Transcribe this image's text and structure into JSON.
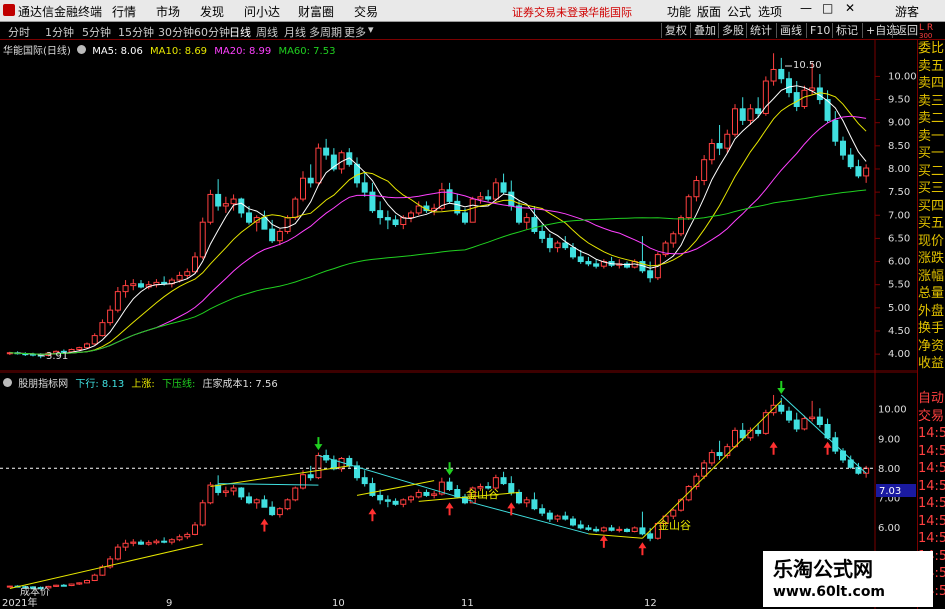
{
  "menu": {
    "logo_text": "通达信金融终端",
    "items": [
      "行情",
      "市场",
      "发现",
      "问小达",
      "财富圈",
      "交易"
    ],
    "broker_status": "证券交易未登录",
    "broker_name": "华能国际",
    "right_items": [
      "功能",
      "版面",
      "公式",
      "选项"
    ],
    "guest": "游客"
  },
  "toolbar": {
    "timeframes": [
      "分时",
      "1分钟",
      "5分钟",
      "15分钟",
      "30分钟",
      "60分钟",
      "日线",
      "周线",
      "月线",
      "多周期",
      "更多"
    ],
    "selected": "日线",
    "buttons": [
      "复权",
      "叠加",
      "多股",
      "统计",
      "画线",
      "F10",
      "标记",
      "+自选",
      "返回"
    ]
  },
  "main_panel": {
    "stock_title": "华能国际(日线)",
    "ma5": "MA5: 8.06",
    "ma10": "MA10: 8.69",
    "ma20": "MA20: 8.99",
    "ma60": "MA60: 7.53",
    "high_label": "10.50",
    "low_label": "3.91",
    "colors": {
      "ma5": "#ffffff",
      "ma10": "#e6e600",
      "ma20": "#ff40ff",
      "ma60": "#20d020",
      "up": "#ff4040",
      "down": "#40e0e0"
    },
    "axis_labels": [
      "10.00",
      "9.50",
      "9.00",
      "8.50",
      "8.00",
      "7.50",
      "7.00",
      "6.50",
      "6.00",
      "5.50",
      "5.00",
      "4.50",
      "4.00"
    ]
  },
  "sub_panel": {
    "title": "股朋指标网",
    "line1_label": "下行: 8.13",
    "line2_label": "上涨:",
    "line3_label": "下压线:",
    "line4_label": "庄家成本1: 7.56",
    "axis_labels": [
      "10.00",
      "9.00",
      "8.00",
      "7.00",
      "6.00"
    ],
    "last_value": "7.03",
    "gold_valley_1": "金山谷",
    "gold_valley_2": "金山谷",
    "bottom_label": "成本价"
  },
  "dates": [
    "2021年",
    "9",
    "10",
    "11",
    "12"
  ],
  "right_column": [
    "委比",
    "卖五",
    "卖四",
    "卖三",
    "卖二",
    "卖一",
    "买一",
    "买二",
    "买三",
    "买四",
    "买五",
    "现价",
    "涨跌",
    "涨幅",
    "总量",
    "外盘",
    "换手",
    "净资",
    "收益",
    "",
    "自动",
    "交易",
    "14:56",
    "14:56",
    "14:56",
    "14:56",
    "14:56",
    "14:56",
    "14:56",
    "14:56",
    "14:56",
    "14:56"
  ],
  "corner": {
    "l": "L",
    "r": "R",
    "n": "300"
  },
  "watermark": {
    "title": "乐淘公式网",
    "url": "www.60lt.com"
  },
  "chart_data": {
    "type": "candlestick",
    "ylim": [
      3.7,
      10.7
    ],
    "candles": [
      [
        4.02,
        4.05,
        3.98,
        4.03
      ],
      [
        4.03,
        4.06,
        3.99,
        4.01
      ],
      [
        4.01,
        4.04,
        3.96,
        4.0
      ],
      [
        4.0,
        4.03,
        3.95,
        3.98
      ],
      [
        3.98,
        4.02,
        3.91,
        3.97
      ],
      [
        3.97,
        4.04,
        3.95,
        4.02
      ],
      [
        4.02,
        4.08,
        4.0,
        4.06
      ],
      [
        4.06,
        4.1,
        4.02,
        4.05
      ],
      [
        4.05,
        4.12,
        4.03,
        4.1
      ],
      [
        4.1,
        4.16,
        4.07,
        4.14
      ],
      [
        4.14,
        4.25,
        4.12,
        4.22
      ],
      [
        4.22,
        4.45,
        4.2,
        4.4
      ],
      [
        4.4,
        4.75,
        4.38,
        4.68
      ],
      [
        4.68,
        5.05,
        4.62,
        4.95
      ],
      [
        4.95,
        5.45,
        4.9,
        5.35
      ],
      [
        5.35,
        5.6,
        5.22,
        5.48
      ],
      [
        5.48,
        5.62,
        5.38,
        5.52
      ],
      [
        5.52,
        5.6,
        5.42,
        5.45
      ],
      [
        5.45,
        5.58,
        5.4,
        5.5
      ],
      [
        5.5,
        5.62,
        5.44,
        5.55
      ],
      [
        5.55,
        5.68,
        5.48,
        5.52
      ],
      [
        5.52,
        5.65,
        5.44,
        5.6
      ],
      [
        5.6,
        5.78,
        5.55,
        5.7
      ],
      [
        5.7,
        5.85,
        5.62,
        5.78
      ],
      [
        5.78,
        6.2,
        5.75,
        6.1
      ],
      [
        6.1,
        6.95,
        6.05,
        6.85
      ],
      [
        6.85,
        7.55,
        6.8,
        7.45
      ],
      [
        7.45,
        7.78,
        7.1,
        7.2
      ],
      [
        7.2,
        7.4,
        7.05,
        7.25
      ],
      [
        7.25,
        7.45,
        7.1,
        7.35
      ],
      [
        7.35,
        7.38,
        6.95,
        7.05
      ],
      [
        7.05,
        7.2,
        6.8,
        6.85
      ],
      [
        6.85,
        7.0,
        6.65,
        6.95
      ],
      [
        6.95,
        7.1,
        6.8,
        6.7
      ],
      [
        6.7,
        6.9,
        6.4,
        6.45
      ],
      [
        6.45,
        6.7,
        6.35,
        6.65
      ],
      [
        6.65,
        7.0,
        6.6,
        6.95
      ],
      [
        6.95,
        7.4,
        6.9,
        7.35
      ],
      [
        7.35,
        7.95,
        7.3,
        7.8
      ],
      [
        7.8,
        8.1,
        7.6,
        7.7
      ],
      [
        7.7,
        8.55,
        7.65,
        8.45
      ],
      [
        8.45,
        8.65,
        8.2,
        8.3
      ],
      [
        8.3,
        8.45,
        7.95,
        8.0
      ],
      [
        8.0,
        8.4,
        7.9,
        8.35
      ],
      [
        8.35,
        8.45,
        8.05,
        8.1
      ],
      [
        8.1,
        8.25,
        7.6,
        7.7
      ],
      [
        7.7,
        7.95,
        7.4,
        7.5
      ],
      [
        7.5,
        7.7,
        7.05,
        7.1
      ],
      [
        7.1,
        7.3,
        6.8,
        6.95
      ],
      [
        6.95,
        7.1,
        6.7,
        6.9
      ],
      [
        6.9,
        7.0,
        6.75,
        6.8
      ],
      [
        6.8,
        7.0,
        6.7,
        6.95
      ],
      [
        6.95,
        7.1,
        6.85,
        7.05
      ],
      [
        7.05,
        7.3,
        7.0,
        7.2
      ],
      [
        7.2,
        7.3,
        7.05,
        7.1
      ],
      [
        7.1,
        7.25,
        7.0,
        7.15
      ],
      [
        7.15,
        7.7,
        7.1,
        7.55
      ],
      [
        7.55,
        7.7,
        7.25,
        7.3
      ],
      [
        7.3,
        7.45,
        7.0,
        7.05
      ],
      [
        7.05,
        7.15,
        6.8,
        6.85
      ],
      [
        6.85,
        7.4,
        6.85,
        7.35
      ],
      [
        7.35,
        7.5,
        7.25,
        7.4
      ],
      [
        7.4,
        7.55,
        7.3,
        7.35
      ],
      [
        7.35,
        7.8,
        7.3,
        7.7
      ],
      [
        7.7,
        7.9,
        7.45,
        7.5
      ],
      [
        7.5,
        7.75,
        7.1,
        7.2
      ],
      [
        7.2,
        7.3,
        6.8,
        6.85
      ],
      [
        6.85,
        7.05,
        6.7,
        6.95
      ],
      [
        6.95,
        7.2,
        6.6,
        6.65
      ],
      [
        6.65,
        6.8,
        6.4,
        6.5
      ],
      [
        6.5,
        6.6,
        6.2,
        6.3
      ],
      [
        6.3,
        6.45,
        6.2,
        6.4
      ],
      [
        6.4,
        6.55,
        6.25,
        6.3
      ],
      [
        6.3,
        6.4,
        6.05,
        6.1
      ],
      [
        6.1,
        6.25,
        5.95,
        6.0
      ],
      [
        6.0,
        6.1,
        5.9,
        5.95
      ],
      [
        5.95,
        6.05,
        5.85,
        5.9
      ],
      [
        5.9,
        6.05,
        5.85,
        6.0
      ],
      [
        6.0,
        6.1,
        5.88,
        5.92
      ],
      [
        5.92,
        6.05,
        5.85,
        5.95
      ],
      [
        5.95,
        6.0,
        5.85,
        5.88
      ],
      [
        5.88,
        6.05,
        5.85,
        6.0
      ],
      [
        6.0,
        6.55,
        5.75,
        5.8
      ],
      [
        5.8,
        6.0,
        5.55,
        5.65
      ],
      [
        5.65,
        6.2,
        5.6,
        6.15
      ],
      [
        6.15,
        6.45,
        6.1,
        6.4
      ],
      [
        6.4,
        6.65,
        6.3,
        6.6
      ],
      [
        6.6,
        7.0,
        6.55,
        6.95
      ],
      [
        6.95,
        7.45,
        6.9,
        7.4
      ],
      [
        7.4,
        7.85,
        7.3,
        7.75
      ],
      [
        7.75,
        8.3,
        7.65,
        8.2
      ],
      [
        8.2,
        8.65,
        8.1,
        8.55
      ],
      [
        8.55,
        8.95,
        8.3,
        8.45
      ],
      [
        8.45,
        8.85,
        8.35,
        8.75
      ],
      [
        8.75,
        9.4,
        8.7,
        9.3
      ],
      [
        9.3,
        9.55,
        8.95,
        9.05
      ],
      [
        9.05,
        9.4,
        8.95,
        9.3
      ],
      [
        9.3,
        9.55,
        9.1,
        9.2
      ],
      [
        9.2,
        10.0,
        9.15,
        9.9
      ],
      [
        9.9,
        10.5,
        9.8,
        10.15
      ],
      [
        10.15,
        10.4,
        9.85,
        9.95
      ],
      [
        9.95,
        10.1,
        9.55,
        9.65
      ],
      [
        9.65,
        9.9,
        9.25,
        9.35
      ],
      [
        9.35,
        9.8,
        9.3,
        9.7
      ],
      [
        9.7,
        10.3,
        9.6,
        9.75
      ],
      [
        9.75,
        10.05,
        9.4,
        9.5
      ],
      [
        9.5,
        9.7,
        9.0,
        9.05
      ],
      [
        9.05,
        9.25,
        8.5,
        8.6
      ],
      [
        8.6,
        8.7,
        8.2,
        8.3
      ],
      [
        8.3,
        8.45,
        8.0,
        8.05
      ],
      [
        8.05,
        8.2,
        7.8,
        7.85
      ],
      [
        7.85,
        8.1,
        7.7,
        8.02
      ]
    ]
  }
}
